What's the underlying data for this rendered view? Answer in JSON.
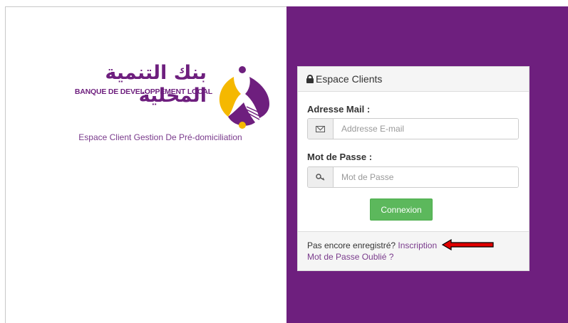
{
  "brand": {
    "name_ar": "بنك التنمية المحلية",
    "name_fr": "BANQUE DE DEVELOPPEMENT LOCAL",
    "tagline": "Espace Client Gestion De Pré-domiciliation",
    "colors": {
      "purple": "#6e1f7e",
      "gold": "#f5b800"
    }
  },
  "login": {
    "title": "Espace Clients",
    "email_label": "Adresse Mail :",
    "email_placeholder": "Addresse E-mail",
    "password_label": "Mot de Passe :",
    "password_placeholder": "Mot de Passe",
    "submit_label": "Connexion",
    "register_prompt": "Pas encore enregistré?",
    "register_link": "Inscription",
    "forgot_link": "Mot de Passe Oublié ?",
    "submit_color": "#5cb85c"
  },
  "icons": {
    "lock": "lock-icon",
    "email": "envelope-icon",
    "password": "key-icon",
    "annotation": "red-arrow-icon"
  }
}
